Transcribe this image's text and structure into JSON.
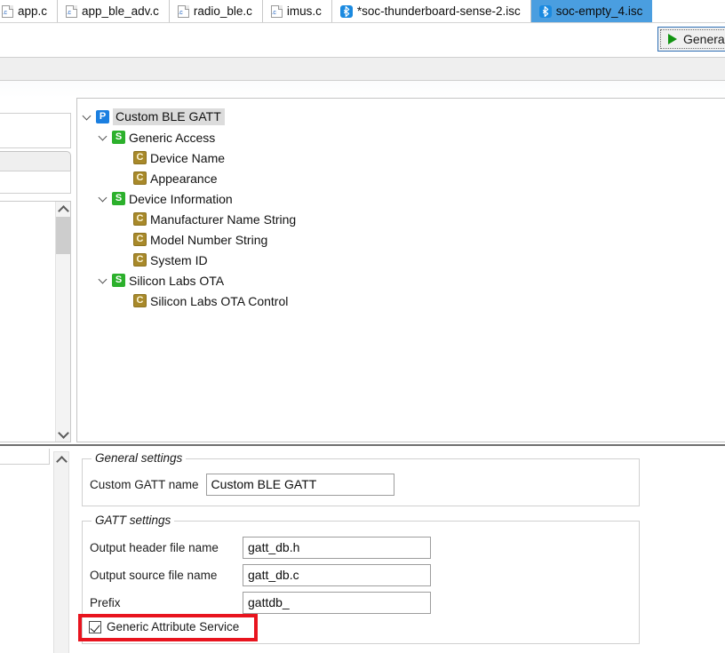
{
  "tabs": [
    {
      "label": "app.c",
      "icon": "c-file-icon",
      "active": false,
      "clipped": true
    },
    {
      "label": "app_ble_adv.c",
      "icon": "c-file-icon",
      "active": false,
      "clipped": false
    },
    {
      "label": "radio_ble.c",
      "icon": "c-file-icon",
      "active": false,
      "clipped": false
    },
    {
      "label": "imus.c",
      "icon": "c-file-icon",
      "active": false,
      "clipped": false
    },
    {
      "label": "*soc-thunderboard-sense-2.isc",
      "icon": "bluetooth-icon",
      "active": false,
      "clipped": false
    },
    {
      "label": "soc-empty_4.isc",
      "icon": "bluetooth-icon",
      "active": true,
      "clipped": false
    }
  ],
  "toolbar": {
    "generate_label": "Generate",
    "generate_icon": "play-triangle-icon",
    "generate_icon_color": "#119311"
  },
  "tree": {
    "nodes": [
      {
        "label": "Custom BLE GATT",
        "type": "profile",
        "icon_letter": "P",
        "depth": 0,
        "expanded": true,
        "selected": true
      },
      {
        "label": "Generic Access",
        "type": "service",
        "icon_letter": "S",
        "depth": 1,
        "expanded": true,
        "selected": false
      },
      {
        "label": "Device Name",
        "type": "characteristic",
        "icon_letter": "C",
        "depth": 2,
        "expanded": null,
        "selected": false
      },
      {
        "label": "Appearance",
        "type": "characteristic",
        "icon_letter": "C",
        "depth": 2,
        "expanded": null,
        "selected": false
      },
      {
        "label": "Device Information",
        "type": "service",
        "icon_letter": "S",
        "depth": 1,
        "expanded": true,
        "selected": false
      },
      {
        "label": "Manufacturer Name String",
        "type": "characteristic",
        "icon_letter": "C",
        "depth": 2,
        "expanded": null,
        "selected": false
      },
      {
        "label": "Model Number String",
        "type": "characteristic",
        "icon_letter": "C",
        "depth": 2,
        "expanded": null,
        "selected": false
      },
      {
        "label": "System ID",
        "type": "characteristic",
        "icon_letter": "C",
        "depth": 2,
        "expanded": null,
        "selected": false
      },
      {
        "label": "Silicon Labs OTA",
        "type": "service",
        "icon_letter": "S",
        "depth": 1,
        "expanded": true,
        "selected": false
      },
      {
        "label": "Silicon Labs OTA Control",
        "type": "characteristic",
        "icon_letter": "C",
        "depth": 2,
        "expanded": null,
        "selected": false
      }
    ]
  },
  "settings": {
    "general": {
      "legend": "General settings",
      "gatt_name_label": "Custom GATT name",
      "gatt_name_value": "Custom BLE GATT"
    },
    "gatt": {
      "legend": "GATT settings",
      "header_label": "Output header file name",
      "header_value": "gatt_db.h",
      "source_label": "Output source file name",
      "source_value": "gatt_db.c",
      "prefix_label": "Prefix",
      "prefix_value": "gattdb_",
      "checkbox_label": "Generic Attribute Service",
      "checkbox_checked": true
    }
  },
  "annotation": {
    "color": "#e8141e",
    "target": "Generic Attribute Service"
  },
  "colors": {
    "profile_icon": "#1b7fe0",
    "service_icon": "#2cb02c",
    "characteristic_icon": "#a8892a",
    "active_tab": "#4a9ee0",
    "bluetooth_icon": "#1b8ae0"
  }
}
